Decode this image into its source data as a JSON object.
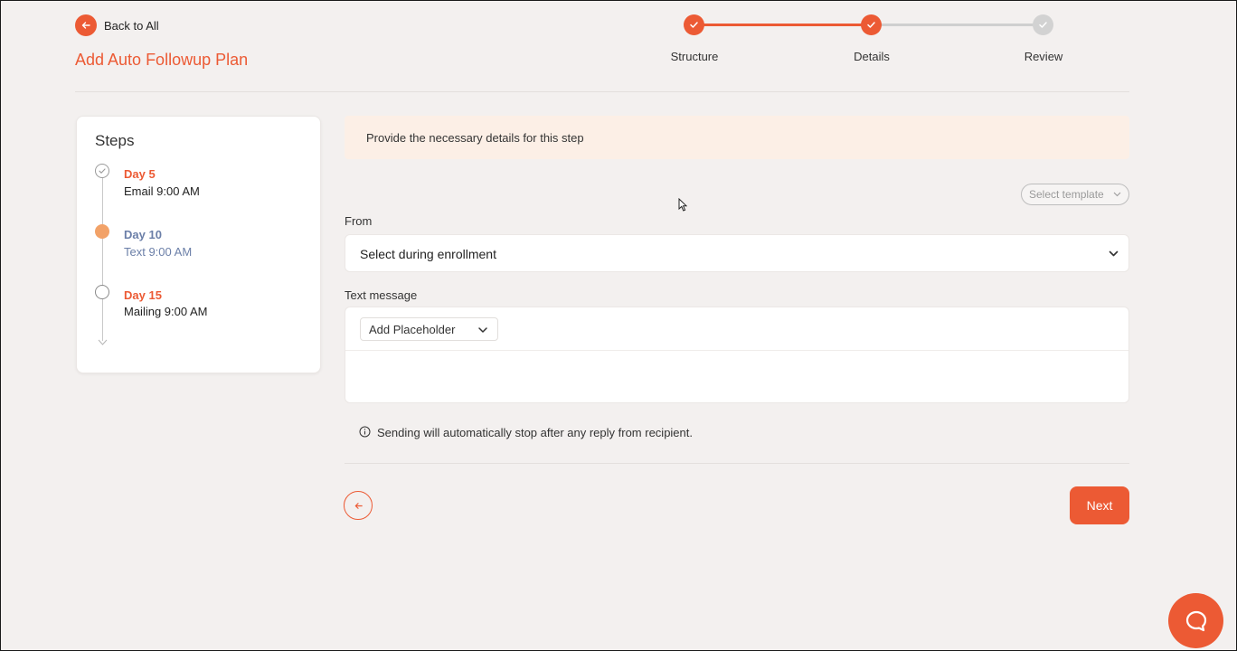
{
  "header": {
    "back_label": "Back to All",
    "title": "Add Auto Followup Plan"
  },
  "stepper": {
    "steps": [
      {
        "label": "Structure",
        "status": "completed"
      },
      {
        "label": "Details",
        "status": "completed"
      },
      {
        "label": "Review",
        "status": "pending"
      }
    ]
  },
  "steps_panel": {
    "title": "Steps",
    "items": [
      {
        "day": "Day 5",
        "desc": "Email 9:00 AM",
        "status": "completed"
      },
      {
        "day": "Day 10",
        "desc": "Text 9:00 AM",
        "status": "active"
      },
      {
        "day": "Day 15",
        "desc": "Mailing 9:00 AM",
        "status": "pending"
      }
    ]
  },
  "main": {
    "banner": "Provide the necessary details for this step",
    "template_select": "Select template",
    "from_label": "From",
    "from_value": "Select during enrollment",
    "text_message_label": "Text message",
    "add_placeholder_label": "Add Placeholder",
    "text_message_value": "",
    "notice": "Sending will automatically stop after any reply from recipient.",
    "next_label": "Next"
  },
  "colors": {
    "accent": "#ec5a34",
    "active_node": "#f2a268",
    "active_text": "#6b7fa8",
    "background": "#f3f0ef",
    "banner": "#fcefe6"
  },
  "icons": {
    "back": "arrow-left-icon",
    "check": "check-icon",
    "chevron": "chevron-down-icon",
    "info": "info-icon",
    "help": "chat-bubble-icon"
  }
}
